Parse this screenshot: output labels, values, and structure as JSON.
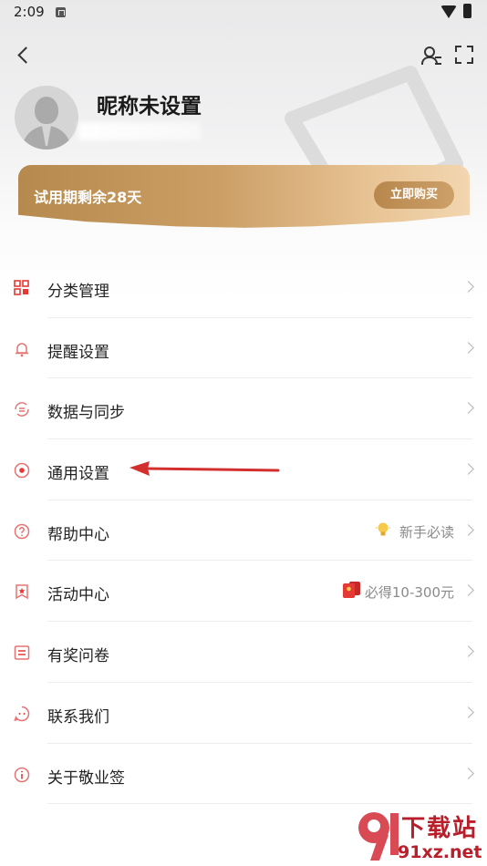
{
  "status_bar": {
    "time": "2:09"
  },
  "profile": {
    "nickname": "昵称未设置"
  },
  "trial_banner": {
    "text": "试用期剩余28天",
    "button_label": "立即购买"
  },
  "menu": [
    {
      "label": "分类管理",
      "icon": "category-grid-icon"
    },
    {
      "label": "提醒设置",
      "icon": "bell-icon"
    },
    {
      "label": "数据与同步",
      "icon": "sync-icon"
    },
    {
      "label": "通用设置",
      "icon": "general-settings-icon"
    },
    {
      "label": "帮助中心",
      "icon": "help-icon",
      "extra": "新手必读",
      "extra_icon": "lightbulb-icon"
    },
    {
      "label": "活动中心",
      "icon": "star-bookmark-icon",
      "extra": "必得10-300元",
      "extra_icon": "red-envelope-icon"
    },
    {
      "label": "有奖问卷",
      "icon": "survey-icon"
    },
    {
      "label": "联系我们",
      "icon": "chat-icon"
    },
    {
      "label": "关于敬业签",
      "icon": "info-icon"
    }
  ],
  "watermark": {
    "title": "下载站",
    "url": "91xz.net"
  },
  "colors": {
    "accent_red": "#e53935",
    "gold": "#c89a5e",
    "watermark_red": "#b81f2a"
  }
}
